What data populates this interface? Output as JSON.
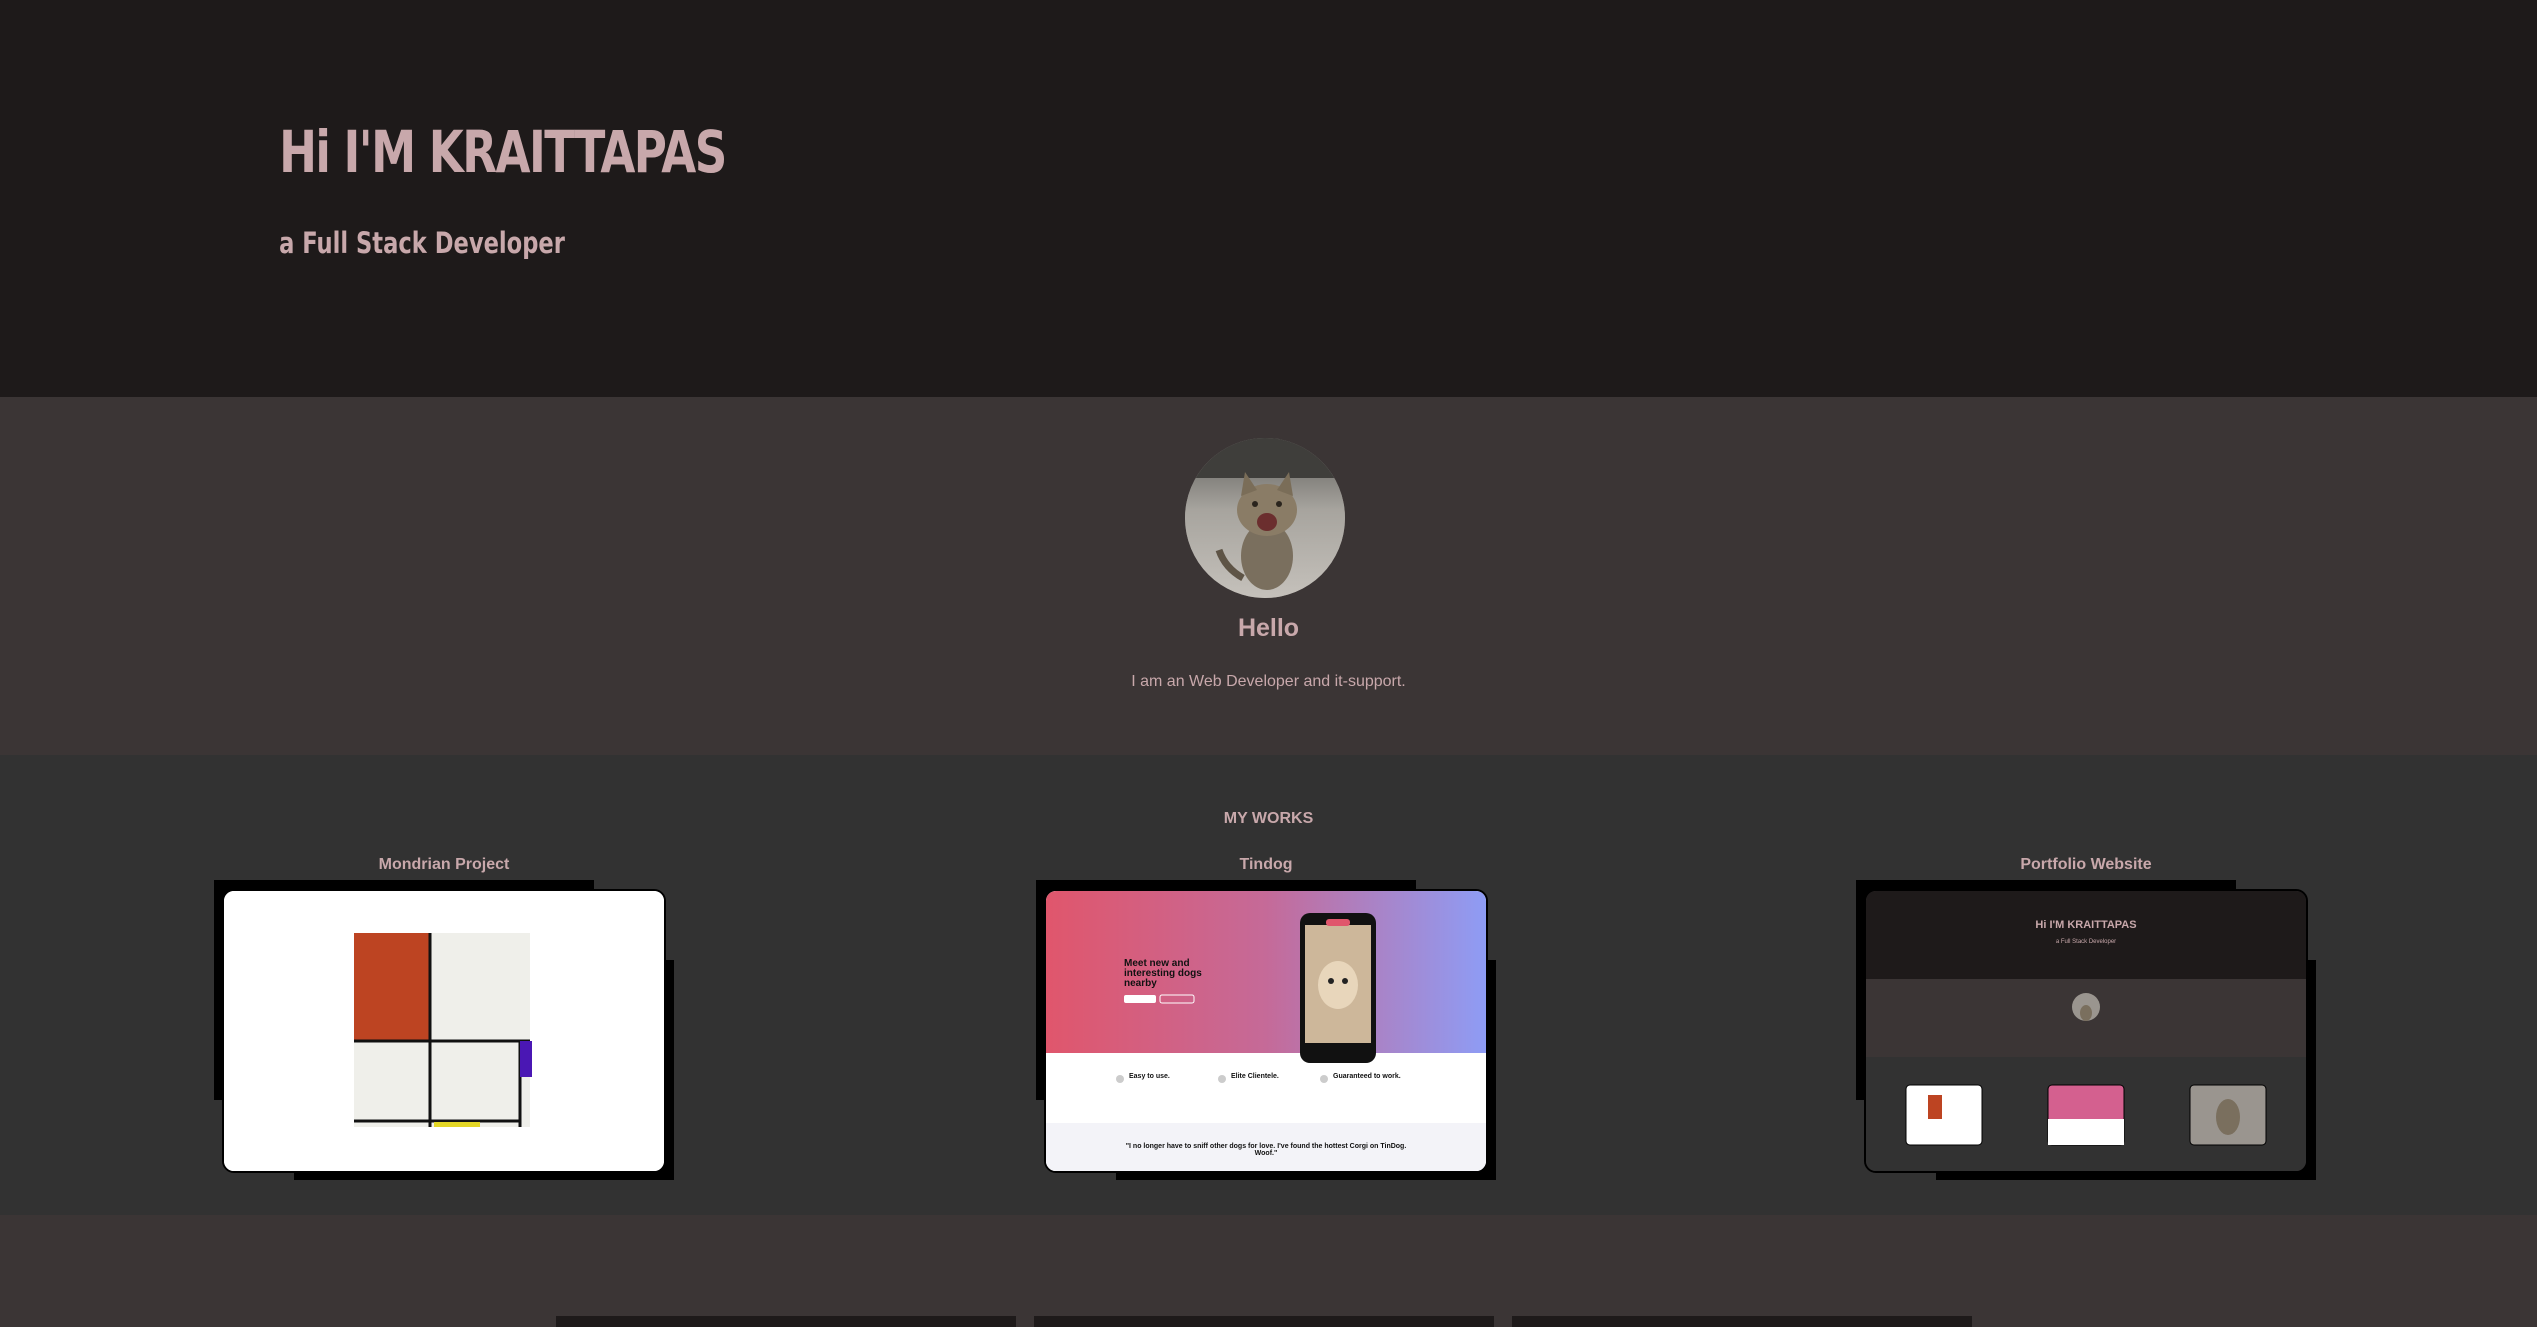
{
  "hero": {
    "title": "Hi I'M KRAITTAPAS",
    "subtitle": "a Full Stack Developer"
  },
  "about": {
    "title": "Hello",
    "text": "I am an Web Developer and it-support."
  },
  "works": {
    "heading": "MY WORKS",
    "items": [
      {
        "title": "Mondrian Project"
      },
      {
        "title": "Tindog"
      },
      {
        "title": "Portfolio Website"
      }
    ]
  },
  "tindog_preview": {
    "headline": "Meet new and interesting dogs nearby",
    "features": [
      "Easy to use.",
      "Elite Clientele.",
      "Guaranteed to work."
    ],
    "testimonial": "\"I no longer have to sniff other dogs for love. I've found the hottest Corgi on TinDog. Woof.\""
  },
  "portfolio_preview": {
    "title": "Hi I'M KRAITTAPAS",
    "subtitle": "a Full Stack Developer"
  },
  "colors": {
    "hero_bg": "#1e1a1a",
    "about_bg": "#3b3535",
    "works_bg": "#323232",
    "text_accent": "#c8a8ab"
  }
}
